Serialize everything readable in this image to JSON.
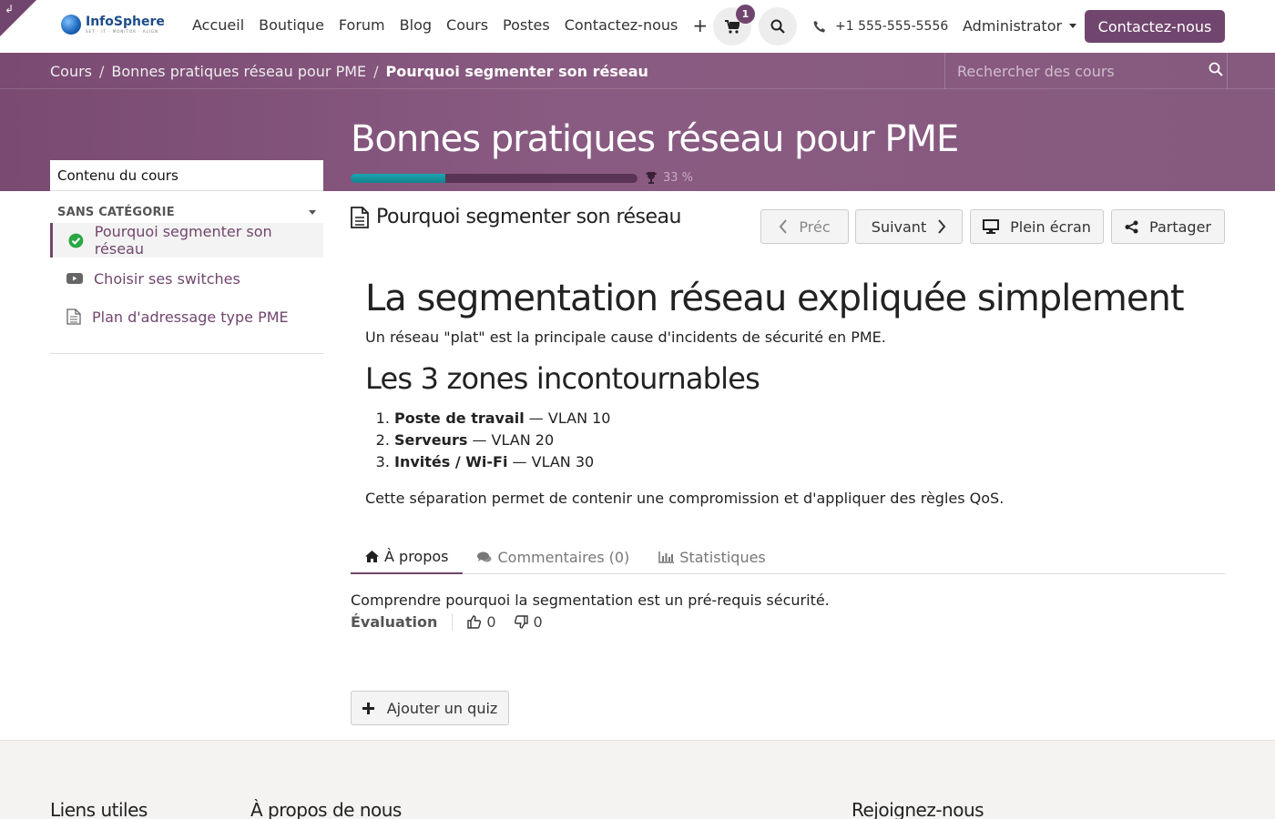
{
  "corner": {
    "glyph": "↲"
  },
  "brand": {
    "name": "InfoSphere",
    "tagline": "SET · IT · MONITOR · ALIGN"
  },
  "nav": {
    "items": [
      "Accueil",
      "Boutique",
      "Forum",
      "Blog",
      "Cours",
      "Postes",
      "Contactez-nous"
    ],
    "plus": "+",
    "cart_count": "1",
    "phone": "+1 555-555-5556",
    "user": "Administrator",
    "cta": "Contactez-nous"
  },
  "breadcrumb": {
    "items": [
      "Cours",
      "Bonnes pratiques réseau pour PME"
    ],
    "separator": "/",
    "current": "Pourquoi segmenter son réseau"
  },
  "course_search": {
    "placeholder": "Rechercher des cours"
  },
  "course": {
    "title": "Bonnes pratiques réseau pour PME",
    "progress_fraction": 0.33,
    "progress_label": "33 %"
  },
  "sidebar": {
    "header": "Contenu du cours",
    "category": "SANS CATÉGORIE",
    "items": [
      {
        "label": "Pourquoi segmenter son réseau",
        "icon": "check-circle-icon"
      },
      {
        "label": "Choisir ses switches",
        "icon": "video-icon"
      },
      {
        "label": "Plan d'adressage type PME",
        "icon": "document-icon"
      }
    ]
  },
  "lesson": {
    "title": "Pourquoi segmenter son réseau",
    "buttons": {
      "prev": "Préc",
      "next": "Suivant",
      "fullscreen": "Plein écran",
      "share": "Partager"
    }
  },
  "content": {
    "h1": "La segmentation réseau expliquée simplement",
    "intro": "Un réseau \"plat\" est la principale cause d'incidents de sécurité en PME.",
    "h2": "Les 3 zones incontournables",
    "zones": [
      {
        "name": "Poste de travail",
        "vlan": " — VLAN 10"
      },
      {
        "name": "Serveurs",
        "vlan": " — VLAN 20"
      },
      {
        "name": "Invités / Wi-Fi",
        "vlan": " — VLAN 30"
      }
    ],
    "outro": "Cette séparation permet de contenir une compromission et d'appliquer des règles QoS."
  },
  "tabs": {
    "about": "À propos",
    "comments": "Commentaires (0)",
    "stats": "Statistiques"
  },
  "about": {
    "description": "Comprendre pourquoi la segmentation est un pré-requis sécurité.",
    "rating_label": "Évaluation",
    "likes": "0",
    "dislikes": "0"
  },
  "quiz": {
    "button": "Ajouter un quiz"
  },
  "footer": {
    "col1": "Liens utiles",
    "col2": "À propos de nous",
    "col3": "Rejoignez-nous"
  },
  "colors": {
    "primary": "#71466e",
    "progress": "#17a2ac",
    "success": "#28a745"
  }
}
